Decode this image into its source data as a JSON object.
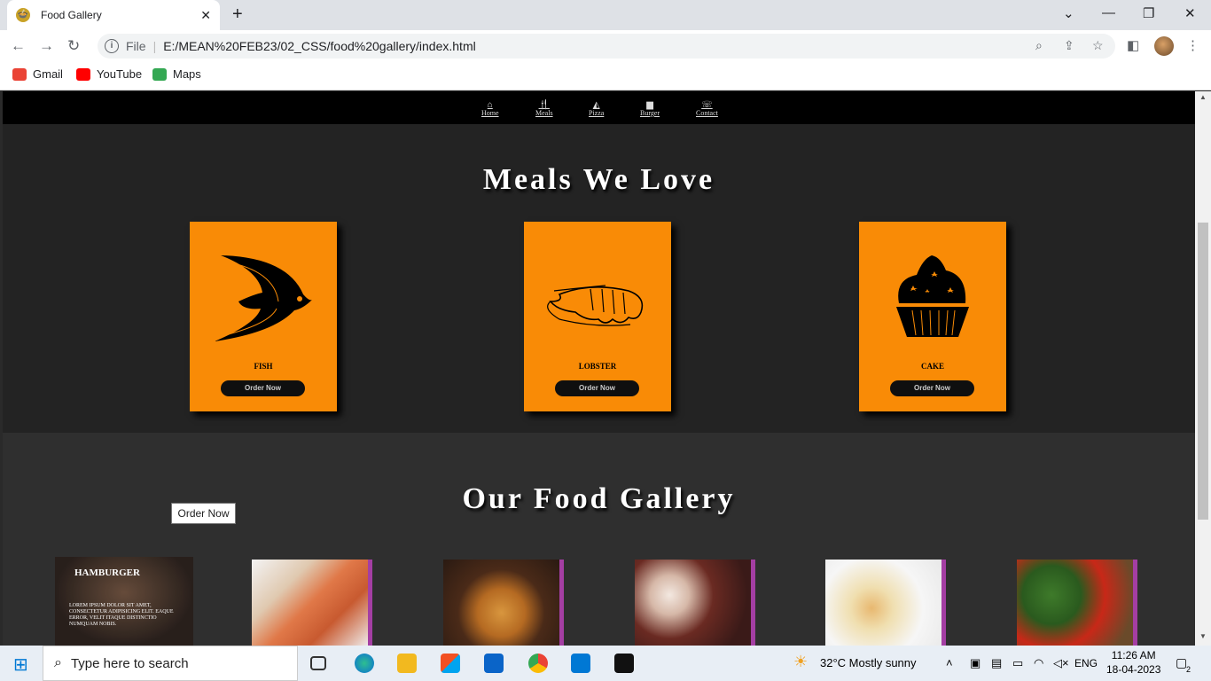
{
  "browser": {
    "tab_title": "Food Gallery",
    "tab_close": "✕",
    "new_tab": "+",
    "window_controls": {
      "chevron": "⌄",
      "minimize": "—",
      "restore": "❐",
      "close": "✕"
    },
    "address": {
      "scheme_label": "File",
      "url": "E:/MEAN%20FEB23/02_CSS/food%20gallery/index.html"
    },
    "nav": {
      "back": "←",
      "forward": "→",
      "reload": "↻"
    },
    "bookmarks": [
      {
        "label": "Gmail",
        "icon": "gmail-icon",
        "color": "#ea4335"
      },
      {
        "label": "YouTube",
        "icon": "youtube-icon",
        "color": "#ff0000"
      },
      {
        "label": "Maps",
        "icon": "maps-icon",
        "color": "#34a853"
      }
    ]
  },
  "page": {
    "nav_items": [
      {
        "label": "Home",
        "glyph": "⌂"
      },
      {
        "label": "Meals",
        "glyph": "🍴"
      },
      {
        "label": "Pizza",
        "glyph": "◭"
      },
      {
        "label": "Burger",
        "glyph": "▆"
      },
      {
        "label": "Contact",
        "glyph": "☏"
      }
    ],
    "meals_title": "Meals We Love",
    "meals": [
      {
        "label": "FISH",
        "button": "Order Now",
        "icon": "fish-icon"
      },
      {
        "label": "LOBSTER",
        "button": "Order Now",
        "icon": "lobster-icon"
      },
      {
        "label": "CAKE",
        "button": "Order Now",
        "icon": "cupcake-icon"
      }
    ],
    "gallery_title": "Our Food Gallery",
    "gallery": {
      "hover_card": {
        "title": "HAMBURGER",
        "text": "LOREM IPSUM DOLOR SIT AMET, CONSECTETUR ADIPISICING ELIT. EAQUE ERROR, VELIT ITAQUE DISTINCTIO NUMQUAM NOBIS.",
        "tooltip": "Order Now"
      },
      "images": [
        {
          "name": "shrimp-image",
          "alt": "Shrimp"
        },
        {
          "name": "pancakes-image",
          "alt": "Pancakes"
        },
        {
          "name": "cupcakes-image",
          "alt": "Cupcakes"
        },
        {
          "name": "toast-image",
          "alt": "Toast"
        },
        {
          "name": "vegetables-image",
          "alt": "Vegetables"
        }
      ]
    },
    "accent_color": "#f98b06",
    "gallery_border_color": "#a43ea3"
  },
  "taskbar": {
    "search_placeholder": "Type here to search",
    "weather": "32°C  Mostly sunny",
    "lang": "ENG",
    "time": "11:26 AM",
    "date": "18-04-2023",
    "notifications": "2"
  }
}
